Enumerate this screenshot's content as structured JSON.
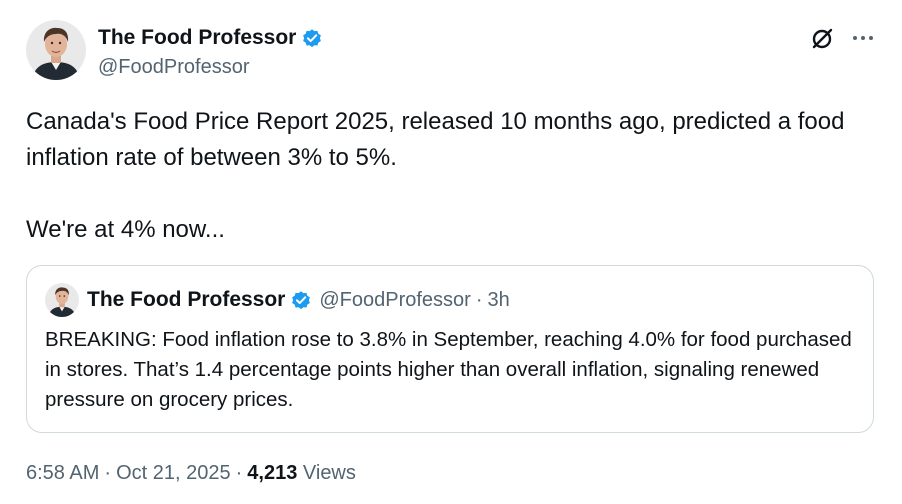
{
  "author": {
    "display_name": "The Food Professor",
    "handle": "@FoodProfessor",
    "verified": true,
    "verified_color": "#1d9bf0"
  },
  "icons": {
    "grok": "grok-icon",
    "more": "more-icon"
  },
  "tweet": {
    "paragraph_1": "Canada's Food Price Report 2025, released 10 months ago, predicted a food inflation rate of between 3% to 5%.",
    "paragraph_2": "We're at 4% now..."
  },
  "quoted_tweet": {
    "display_name": "The Food Professor",
    "handle": "@FoodProfessor",
    "separator": "·",
    "time": "3h",
    "text": "BREAKING: Food inflation rose to 3.8% in September, reaching 4.0% for food purchased in stores. That’s 1.4 percentage points higher than overall inflation, signaling renewed pressure on grocery prices."
  },
  "meta": {
    "time": "6:58 AM",
    "separator": "·",
    "date": "Oct 21, 2025",
    "views_count": "4,213",
    "views_label": "Views"
  }
}
